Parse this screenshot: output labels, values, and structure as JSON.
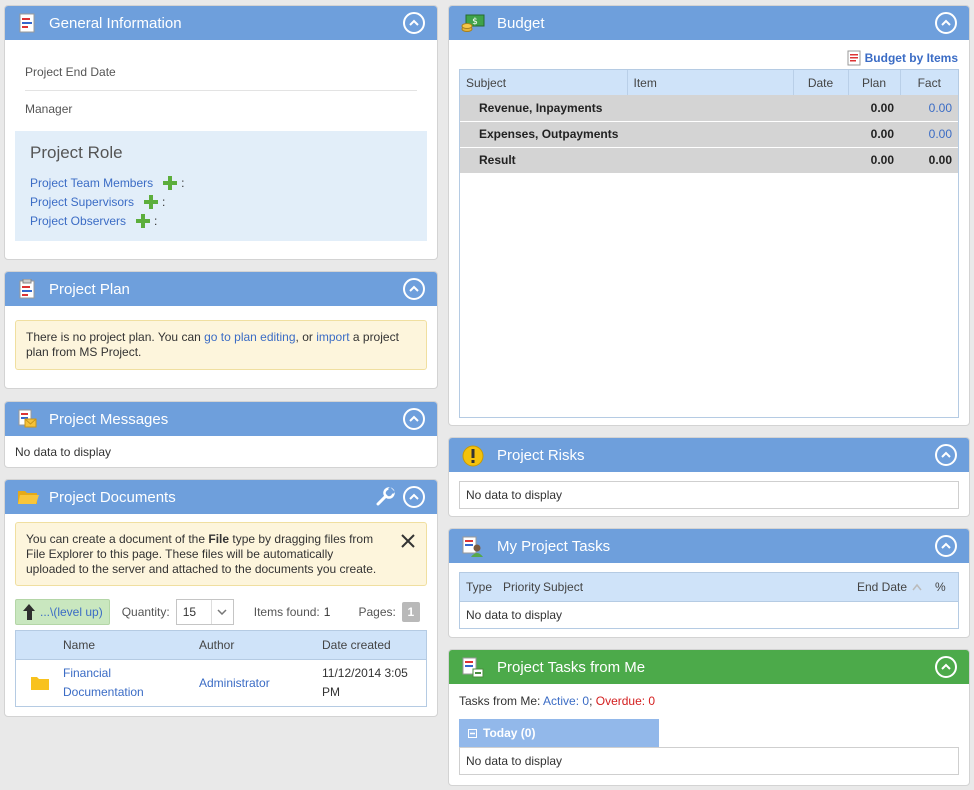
{
  "general": {
    "title": "General Information",
    "end_date_label": "Project End Date",
    "manager_label": "Manager",
    "role_title": "Project Role",
    "roles": [
      {
        "label": "Project Team Members",
        "suffix": ":"
      },
      {
        "label": "Project Supervisors",
        "suffix": ":"
      },
      {
        "label": "Project Observers",
        "suffix": ":"
      }
    ]
  },
  "plan": {
    "title": "Project Plan",
    "notice_part1": "There is no project plan. You can ",
    "notice_link1": "go to plan editing",
    "notice_part2": ", or ",
    "notice_link2": "import",
    "notice_part3": " a project plan from MS Project."
  },
  "messages": {
    "title": "Project Messages",
    "empty": "No data to display"
  },
  "documents": {
    "title": "Project Documents",
    "notice_part1": "You can create a document of the ",
    "notice_bold": "File",
    "notice_part2": " type by dragging files from File Explorer to this page. These files will be automatically uploaded to the server and attached to the documents you create.",
    "level_up": "...\\(level up)",
    "quantity_label": "Quantity:",
    "quantity_value": "15",
    "items_found_label": "Items found:",
    "items_found_value": "1",
    "pages_label": "Pages:",
    "pages_value": "1",
    "columns": [
      "Name",
      "Author",
      "Date created"
    ],
    "rows": [
      {
        "name": "Financial Documentation",
        "author": "Administrator",
        "date": "11/12/2014 3:05 PM"
      }
    ]
  },
  "budget": {
    "title": "Budget",
    "by_items": "Budget by Items",
    "columns": [
      "Subject",
      "Item",
      "Date",
      "Plan",
      "Fact"
    ],
    "rows": [
      {
        "subject": "Revenue, Inpayments",
        "plan": "0.00",
        "fact": "0.00"
      },
      {
        "subject": "Expenses, Outpayments",
        "plan": "0.00",
        "fact": "0.00"
      },
      {
        "subject": "Result",
        "plan": "0.00",
        "fact": "0.00"
      }
    ]
  },
  "risks": {
    "title": "Project Risks",
    "empty": "No data to display"
  },
  "my_tasks": {
    "title": "My Project Tasks",
    "columns": [
      "Type",
      "Priority",
      "Subject",
      "End Date",
      "%"
    ],
    "empty": "No data to display"
  },
  "tasks_from_me": {
    "title": "Project Tasks from Me",
    "summary_label": "Tasks from Me: ",
    "active": "Active: 0",
    "sep": "; ",
    "overdue": "Overdue: 0",
    "group": "Today (0)",
    "empty": "No data to display"
  },
  "colors": {
    "header_blue": "#6e9fdc",
    "header_green": "#4caa4a",
    "link": "#3b6cc5",
    "overdue": "#d42020"
  }
}
